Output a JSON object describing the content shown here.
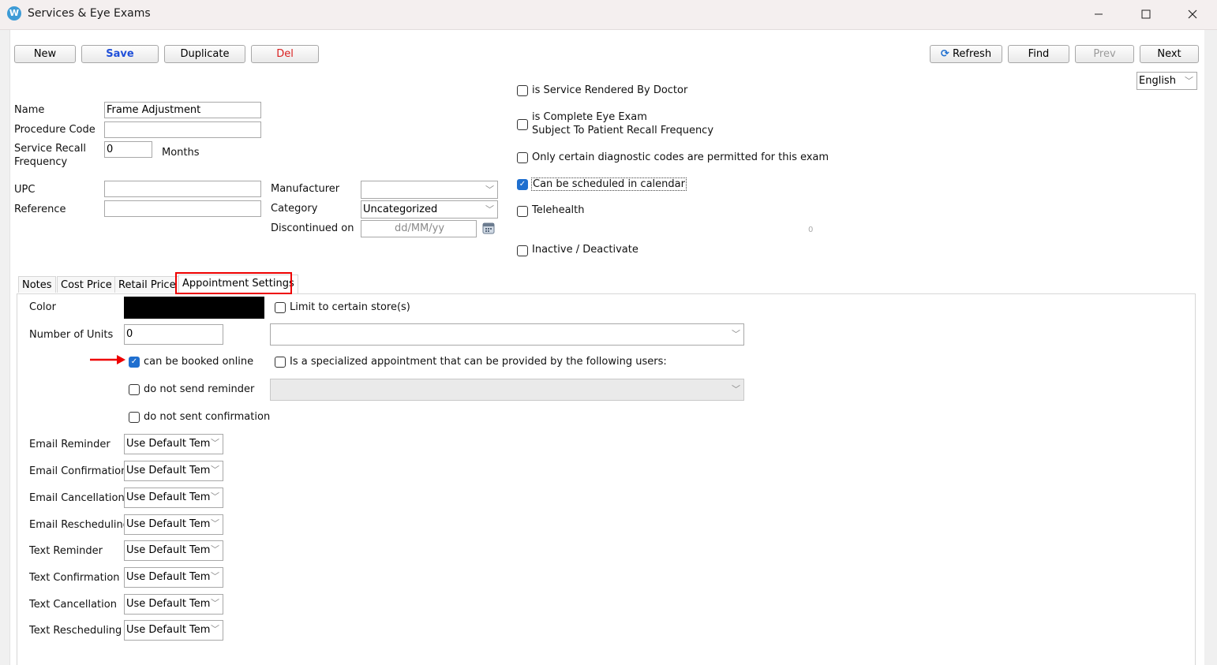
{
  "window": {
    "title": "Services & Eye Exams",
    "app_icon_letter": "W"
  },
  "toolbar": {
    "new": "New",
    "save": "Save",
    "duplicate": "Duplicate",
    "del": "Del",
    "refresh": "Refresh",
    "find": "Find",
    "prev": "Prev",
    "next": "Next",
    "save_color": "#1f4fd9",
    "del_color": "#d91f1f"
  },
  "language": {
    "value": "English"
  },
  "form": {
    "name_label": "Name",
    "name_value": "Frame Adjustment",
    "procedure_code_label": "Procedure Code",
    "procedure_code_value": "",
    "recall_label_1": "Service Recall",
    "recall_label_2": "Frequency",
    "recall_value": "0",
    "recall_unit": "Months",
    "upc_label": "UPC",
    "upc_value": "",
    "reference_label": "Reference",
    "reference_value": "",
    "manufacturer_label": "Manufacturer",
    "manufacturer_value": "",
    "category_label": "Category",
    "category_value": "Uncategorized",
    "discontinued_label": "Discontinued on",
    "discontinued_placeholder": "dd/MM/yy"
  },
  "options": {
    "rendered_by_doctor": "is Service Rendered By Doctor",
    "complete_eye_exam_1": "is Complete Eye Exam",
    "complete_eye_exam_2": "Subject To Patient Recall Frequency",
    "diagnostic_codes": "Only certain diagnostic codes are permitted for this exam",
    "scheduled_calendar": "Can be scheduled in calendar",
    "telehealth": "Telehealth",
    "counter": "0",
    "inactive": "Inactive / Deactivate"
  },
  "tabs": [
    "Notes",
    "Cost Price",
    "Retail Price",
    "Appointment Settings"
  ],
  "appointment": {
    "color_label": "Color",
    "color_value": "#000000",
    "units_label": "Number of Units",
    "units_value": "0",
    "limit_stores": "Limit to certain store(s)",
    "booked_online": "can be booked online",
    "specialized": "Is a specialized appointment that can be provided by the following users:",
    "no_reminder": "do not send reminder",
    "no_confirmation": "do not sent confirmation",
    "templates": [
      {
        "label": "Email Reminder",
        "value": "Use Default Tem"
      },
      {
        "label": "Email Confirmation",
        "value": "Use Default Tem"
      },
      {
        "label": "Email Cancellation",
        "value": "Use Default Tem"
      },
      {
        "label": "Email Rescheduling",
        "value": "Use Default Tem"
      },
      {
        "label": "Text Reminder",
        "value": "Use Default Tem"
      },
      {
        "label": "Text Confirmation",
        "value": "Use Default Tem"
      },
      {
        "label": "Text Cancellation",
        "value": "Use Default Tem"
      },
      {
        "label": "Text Rescheduling",
        "value": "Use Default Tem"
      }
    ]
  },
  "colors": {
    "accent": "#1f6fcf",
    "highlight": "#e00000",
    "arrow": "#e00000"
  }
}
